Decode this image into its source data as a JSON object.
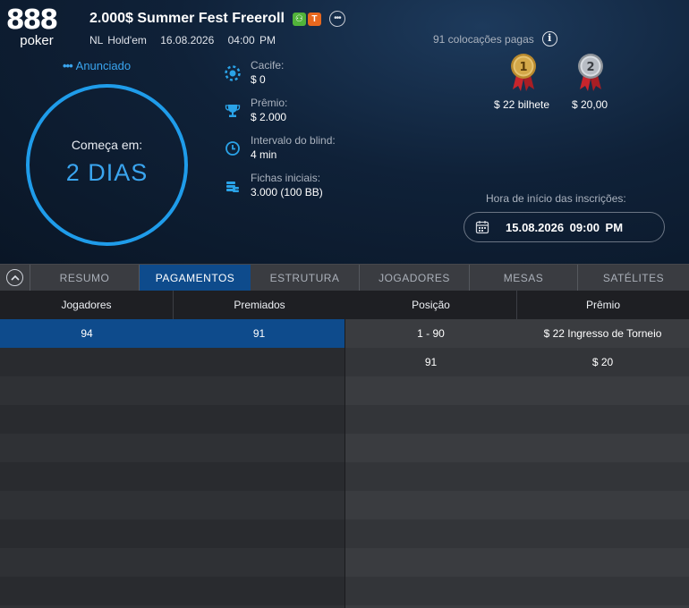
{
  "logo": {
    "number": "888",
    "word": "poker"
  },
  "tournament": {
    "title": "2.000$ Summer Fest Freeroll",
    "badge_green": "⚇",
    "badge_orange": "T",
    "more": "•••",
    "game": "NL Hold'em",
    "date": "16.08.2026",
    "time": "04:00 PM",
    "status_dots": "•••",
    "status": "Anunciado"
  },
  "countdown": {
    "label": "Começa em:",
    "value": "2 DIAS"
  },
  "info": {
    "buyin_label": "Cacife:",
    "buyin_value": "$ 0",
    "prize_label": "Prêmio:",
    "prize_value": "$ 2.000",
    "blind_label": "Intervalo do blind:",
    "blind_value": "4 min",
    "chips_label": "Fichas iniciais:",
    "chips_value": "3.000 (100 BB)"
  },
  "payouts_summary": {
    "paid_places": "91 colocações pagas",
    "info_glyph": "i",
    "first_rank": "1",
    "first_prize": "$ 22 bilhete",
    "second_rank": "2",
    "second_prize": "$ 20,00"
  },
  "registration": {
    "label": "Hora de início das inscrições:",
    "datetime": "15.08.2026 09:00 PM"
  },
  "tabs": [
    "RESUMO",
    "PAGAMENTOS",
    "ESTRUTURA",
    "JOGADORES",
    "MESAS",
    "SATÉLITES"
  ],
  "active_tab": "PAGAMENTOS",
  "table": {
    "headers": [
      "Jogadores",
      "Premiados",
      "Posição",
      "Prêmio"
    ],
    "left_rows": [
      {
        "players": "94",
        "awarded": "91"
      }
    ],
    "right_rows": [
      {
        "position": "1 - 90",
        "prize": "$ 22 Ingresso de Torneio"
      },
      {
        "position": "91",
        "prize": "$ 20"
      }
    ]
  },
  "colors": {
    "accent": "#1f9cea",
    "active_tab": "#0e4b8c",
    "badge_green": "#52b33a",
    "badge_orange": "#e8681e"
  }
}
